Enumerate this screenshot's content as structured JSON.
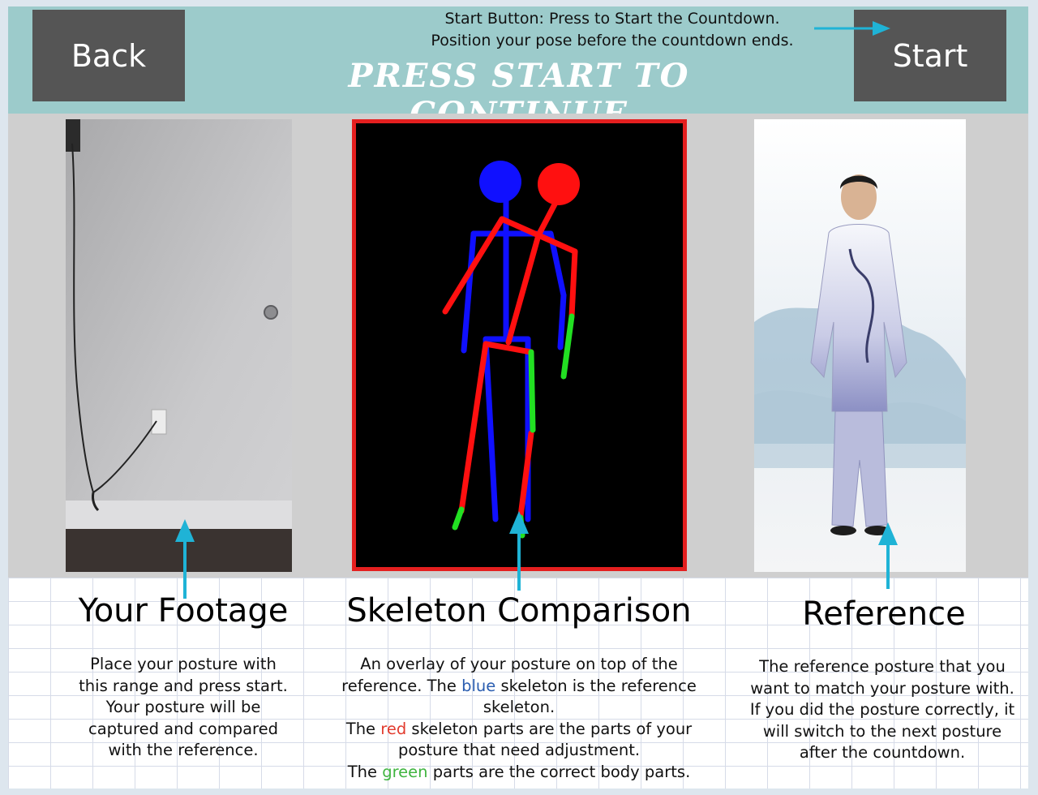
{
  "header": {
    "back_label": "Back",
    "start_label": "Start",
    "headline": "PRESS START TO CONTINUE",
    "callout_line1": "Start Button: Press to Start the Countdown.",
    "callout_line2": "Position your pose before the countdown ends."
  },
  "columns": {
    "footage": {
      "title": "Your Footage",
      "desc": [
        "Place your posture with",
        "this range and press start.",
        "Your posture will be",
        "captured and compared",
        "with the reference."
      ]
    },
    "skeleton": {
      "title": "Skeleton Comparison",
      "line1": "An overlay of your posture on top of the",
      "line2_pre": "reference. The ",
      "line2_blue": "blue",
      "line2_post": " skeleton is the reference",
      "line3": "skeleton.",
      "line4_pre": "The ",
      "line4_red": "red",
      "line4_post": " skeleton parts are the  parts of your",
      "line5": "posture that need adjustment.",
      "line6_pre": "The ",
      "line6_green": "green",
      "line6_post": " parts are the correct body parts."
    },
    "reference": {
      "title": "Reference",
      "desc": [
        "The reference posture that you",
        "want to match your posture with.",
        "If you did the posture correctly, it",
        "will switch to the next posture",
        "after the countdown."
      ]
    }
  },
  "colors": {
    "header_bg": "#9ccbcb",
    "button_bg": "#555555",
    "annotation_arrow": "#1fb3d6",
    "skeleton_blue": "#1010ff",
    "skeleton_red": "#ff1010",
    "skeleton_green": "#22e022",
    "panel_border": "#e41f1f"
  },
  "icons": [
    "arrow-right-icon",
    "arrow-up-icon"
  ]
}
